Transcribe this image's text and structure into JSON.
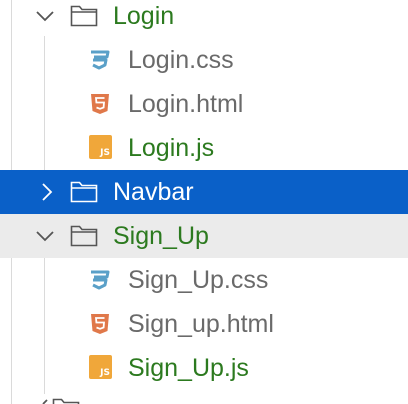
{
  "tree": {
    "items": [
      {
        "label": "Login",
        "type": "folder",
        "state": "expanded"
      },
      {
        "label": "Login.css",
        "type": "css"
      },
      {
        "label": "Login.html",
        "type": "html"
      },
      {
        "label": "Login.js",
        "type": "js",
        "badge": "JS"
      },
      {
        "label": "Navbar",
        "type": "folder",
        "state": "collapsed"
      },
      {
        "label": "Sign_Up",
        "type": "folder",
        "state": "expanded"
      },
      {
        "label": "Sign_Up.css",
        "type": "css"
      },
      {
        "label": "Sign_up.html",
        "type": "html"
      },
      {
        "label": "Sign_Up.js",
        "type": "js",
        "badge": "JS"
      }
    ]
  },
  "colors": {
    "selected_bg": "#0a60c8",
    "hover_bg": "#ebebeb",
    "modified_text": "#2c7a1f",
    "default_text": "#6a6a6a",
    "css_icon": "#5aa0c8",
    "html_icon": "#e0784a",
    "js_icon": "#f0a73a"
  }
}
